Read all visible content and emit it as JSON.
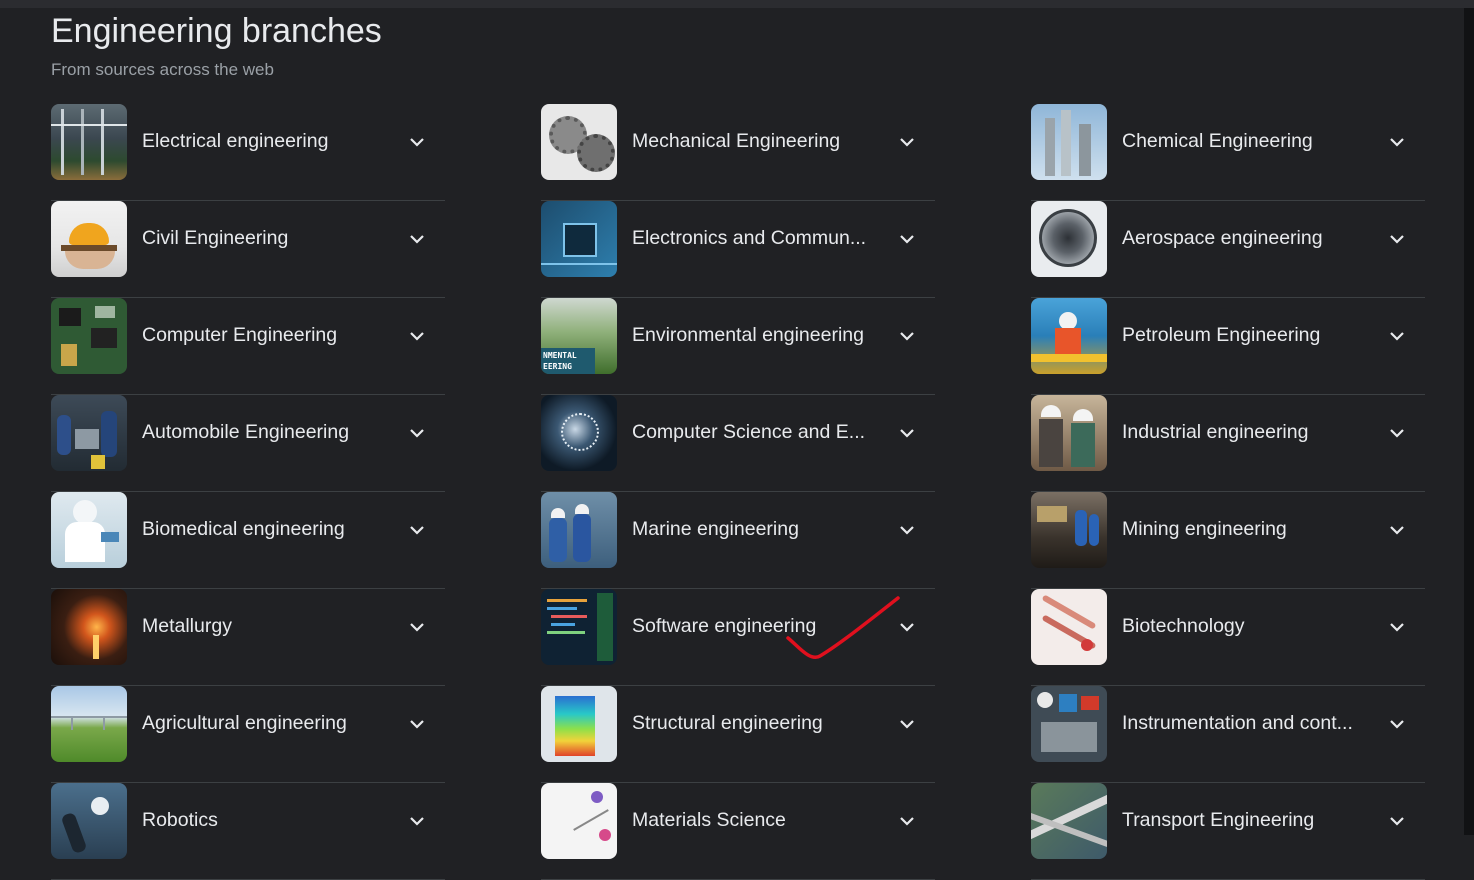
{
  "header": {
    "title": "Engineering branches",
    "subtitle": "From sources across the web"
  },
  "columns": [
    {
      "items": [
        {
          "label": "Electrical engineering"
        },
        {
          "label": "Civil Engineering"
        },
        {
          "label": "Computer Engineering"
        },
        {
          "label": "Automobile Engineering"
        },
        {
          "label": "Biomedical engineering"
        },
        {
          "label": "Metallurgy"
        },
        {
          "label": "Agricultural engineering"
        },
        {
          "label": "Robotics"
        }
      ]
    },
    {
      "items": [
        {
          "label": "Mechanical Engineering"
        },
        {
          "label": "Electronics and Commun..."
        },
        {
          "label": "Environmental engineering"
        },
        {
          "label": "Computer Science and E..."
        },
        {
          "label": "Marine engineering"
        },
        {
          "label": "Software engineering"
        },
        {
          "label": "Structural engineering"
        },
        {
          "label": "Materials Science"
        }
      ]
    },
    {
      "items": [
        {
          "label": "Chemical Engineering"
        },
        {
          "label": "Aerospace engineering"
        },
        {
          "label": "Petroleum Engineering"
        },
        {
          "label": "Industrial engineering"
        },
        {
          "label": "Mining engineering"
        },
        {
          "label": "Biotechnology"
        },
        {
          "label": "Instrumentation and cont..."
        },
        {
          "label": "Transport Engineering"
        }
      ]
    }
  ],
  "thumb_text": {
    "environmental": "NMENTAL\nEERING"
  },
  "colors": {
    "background": "#202124",
    "text": "#e8eaed",
    "subtext": "#9aa0a6",
    "divider": "#3c4043",
    "annotation": "#e0101e"
  }
}
